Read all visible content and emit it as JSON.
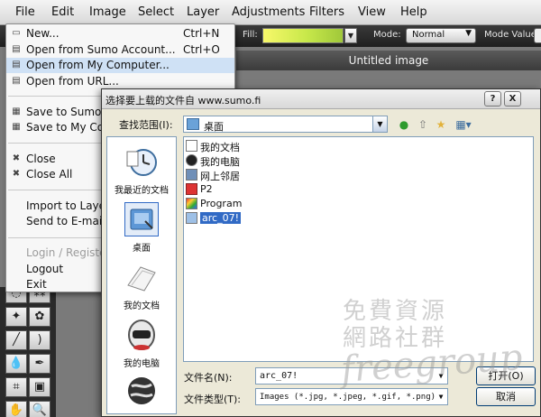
{
  "menubar": {
    "items": [
      "File",
      "Edit",
      "Image",
      "Select",
      "Layer",
      "Adjustments",
      "Filters",
      "View",
      "Help"
    ]
  },
  "options_bar": {
    "fill_label": "Fill:",
    "mode_label": "Mode:",
    "mode_value": "Normal",
    "mode_value_label": "Mode Value:",
    "fill_gradient_colors": [
      "#f8f86a",
      "#a0c83a"
    ]
  },
  "document": {
    "title": "Untitled image"
  },
  "file_menu": {
    "items": [
      {
        "label": "New...",
        "shortcut": "Ctrl+N",
        "icon": "blank-icon"
      },
      {
        "label": "Open from Sumo Account...",
        "shortcut": "Ctrl+O",
        "icon": "folder-icon"
      },
      {
        "label": "Open from My Computer...",
        "shortcut": "",
        "icon": "folder-open-icon",
        "highlighted": true
      },
      {
        "label": "Open from URL...",
        "shortcut": "",
        "icon": "url-icon"
      },
      {
        "label": "Save to Sumo Ac",
        "shortcut": "",
        "icon": "save-icon"
      },
      {
        "label": "Save to My Comp",
        "shortcut": "",
        "icon": "save-computer-icon"
      },
      {
        "label": "Close",
        "shortcut": "",
        "icon": "close-icon"
      },
      {
        "label": "Close All",
        "shortcut": "",
        "icon": "close-all-icon"
      },
      {
        "label": "Import to Layer",
        "shortcut": "",
        "icon": ""
      },
      {
        "label": "Send to E-mail...",
        "shortcut": "",
        "icon": ""
      },
      {
        "label": "Login / Register...",
        "shortcut": "",
        "icon": "",
        "disabled": true
      },
      {
        "label": "Logout",
        "shortcut": "",
        "icon": ""
      },
      {
        "label": "Exit",
        "shortcut": "",
        "icon": ""
      }
    ]
  },
  "dialog": {
    "title": "选择要上载的文件自 www.sumo.fi",
    "help_btn": "?",
    "close_btn": "X",
    "look_in_label": "查找范围(I):",
    "look_in_value": "桌面",
    "places": [
      {
        "label": "我最近的文档",
        "icon": "recent-documents-icon"
      },
      {
        "label": "桌面",
        "icon": "desktop-icon"
      },
      {
        "label": "我的文档",
        "icon": "my-documents-icon"
      },
      {
        "label": "我的电脑",
        "icon": "my-computer-icon"
      },
      {
        "label": "",
        "icon": "network-globe-icon"
      }
    ],
    "files": [
      {
        "name": "我的文档",
        "icon": "documents-folder-icon"
      },
      {
        "name": "我的电脑",
        "icon": "computer-icon"
      },
      {
        "name": "网上邻居",
        "icon": "network-icon"
      },
      {
        "name": "P2",
        "icon": "p2-icon"
      },
      {
        "name": "Program",
        "icon": "program-icon"
      },
      {
        "name": "arc_07!",
        "icon": "folder-icon",
        "selected": true
      }
    ],
    "filename_label": "文件名(N):",
    "filename_value": "arc_07!",
    "filetype_label": "文件类型(T):",
    "filetype_value": "Images (*.jpg, *.jpeg, *.gif, *.png)",
    "open_btn": "打开(O)",
    "cancel_btn": "取消"
  },
  "watermark": {
    "line1": "免費資源",
    "line2": "網路社群",
    "line3": "freegroup"
  }
}
